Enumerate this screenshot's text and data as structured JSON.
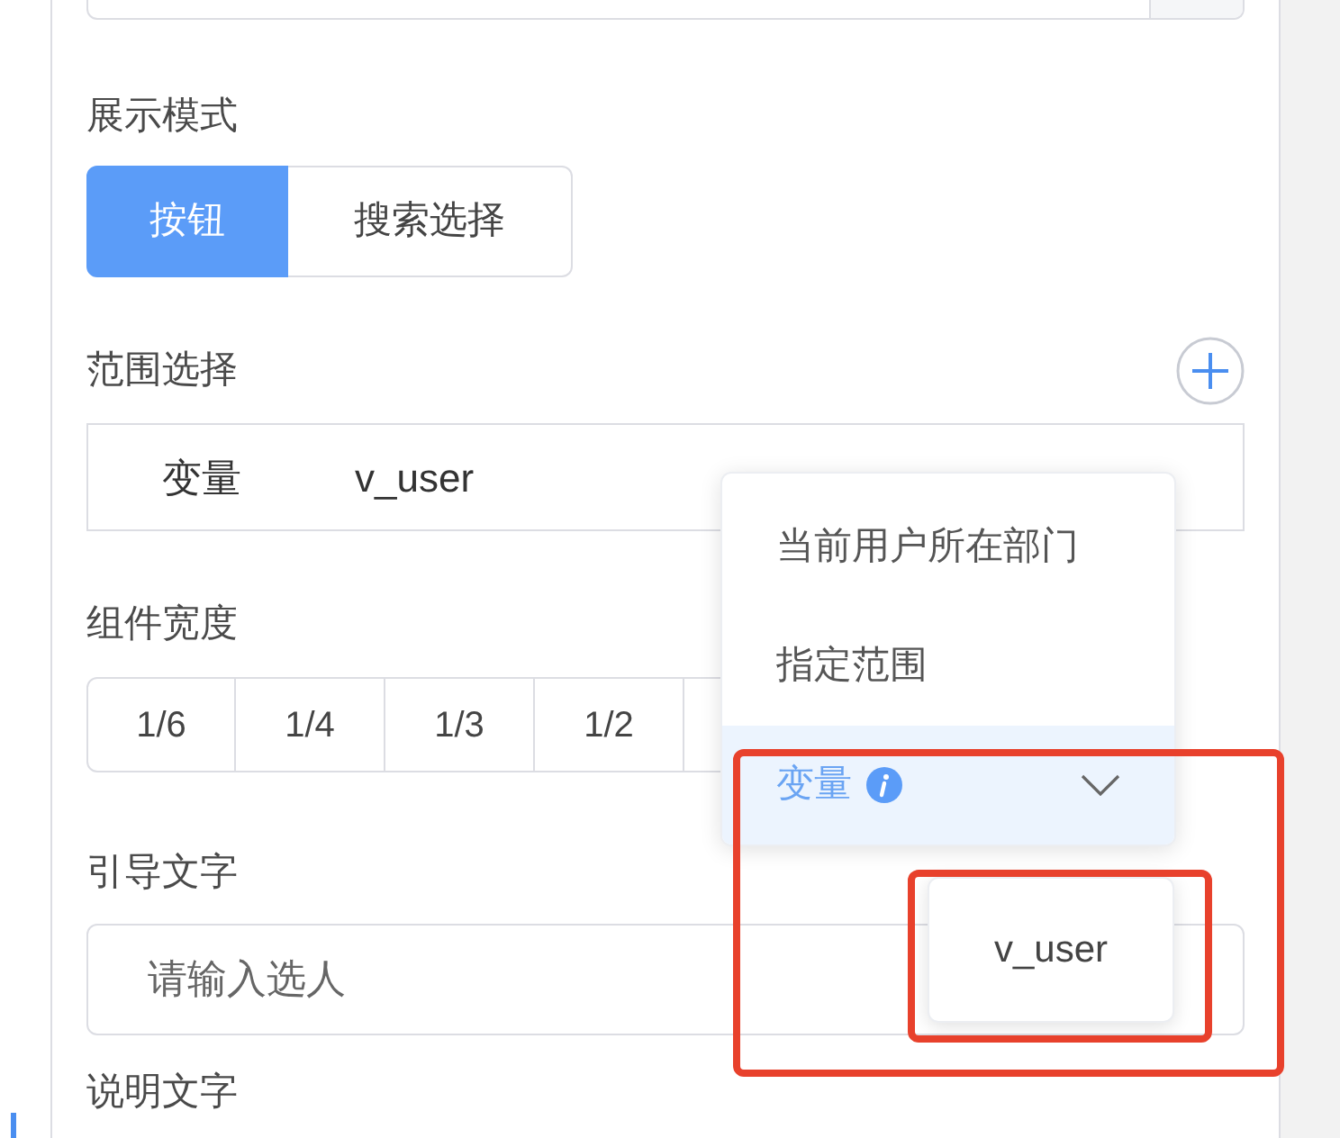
{
  "display_mode": {
    "label": "展示模式",
    "options": [
      {
        "label": "按钮",
        "selected": true
      },
      {
        "label": "搜索选择",
        "selected": false
      }
    ]
  },
  "range": {
    "label": "范围选择",
    "type_label": "变量",
    "value": "v_user"
  },
  "width": {
    "label": "组件宽度",
    "options": [
      {
        "label": "1/6",
        "selected": false
      },
      {
        "label": "1/4",
        "selected": false
      },
      {
        "label": "1/3",
        "selected": false
      },
      {
        "label": "1/2",
        "selected": false
      }
    ]
  },
  "guide_text": {
    "label": "引导文字",
    "placeholder": "请输入选人"
  },
  "description": {
    "label": "说明文字"
  },
  "dropdown": {
    "items": [
      {
        "label": "当前用户所在部门",
        "kind": "plain",
        "selected": false
      },
      {
        "label": "指定范围",
        "kind": "plain",
        "selected": false
      },
      {
        "label": "变量",
        "kind": "submenu",
        "selected": true
      }
    ]
  },
  "submenu": {
    "items": [
      {
        "label": "v_user"
      }
    ]
  }
}
